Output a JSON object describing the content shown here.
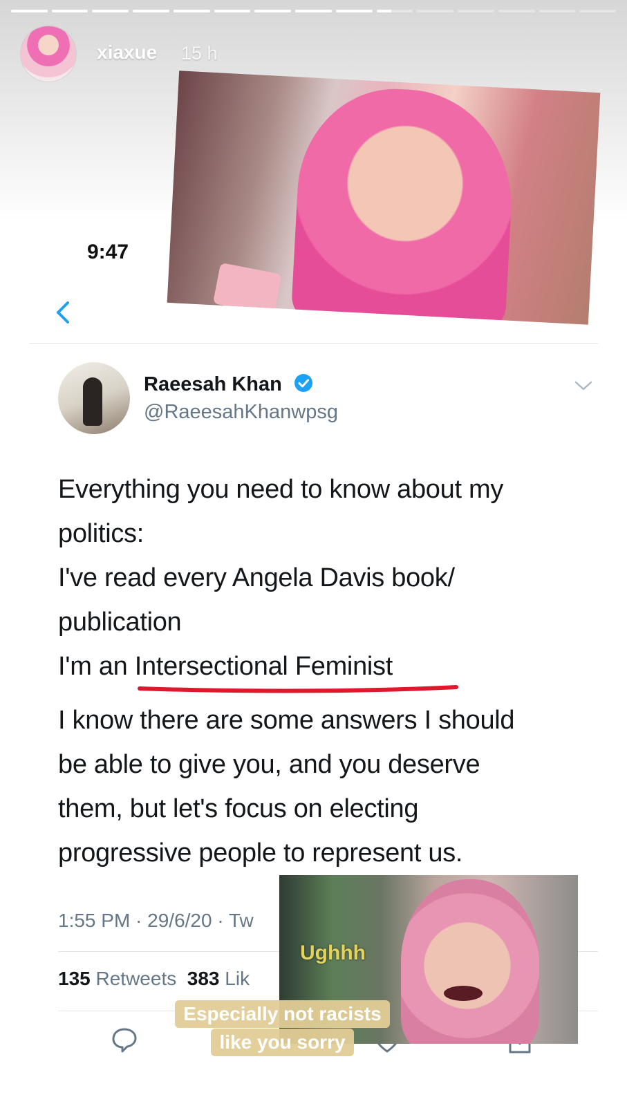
{
  "story": {
    "username": "xiaxue",
    "time_ago": "15 h",
    "progress_segments": 15,
    "progress_current_index": 9
  },
  "status_bar": {
    "time": "9:47"
  },
  "tweet": {
    "display_name": "Raeesah Khan",
    "handle": "@RaeesahKhanwpsg",
    "verified": true,
    "body_lines": [
      "Everything you need to know about my",
      "politics:",
      "I've read every Angela Davis book/",
      "publication",
      "I'm an ",
      "Intersectional Feminist",
      "I know there are some answers I should",
      "be able to give you, and you deserve",
      "them, but let's focus on electing",
      "progressive people to represent us."
    ],
    "meta": "1:55 PM · 29/6/20 · Tw",
    "retweets_count": "135",
    "retweets_label": "Retweets",
    "likes_count": "383",
    "likes_label": "Lik"
  },
  "stickers": {
    "gif_text": "Ughhh",
    "caption_line1": "Especially not racists",
    "caption_line2": "like you sorry"
  },
  "icons": {
    "back": "chevron-left-icon",
    "verified": "verified-badge-icon",
    "more": "chevron-down-icon",
    "reply": "reply-icon",
    "like": "heart-icon",
    "share": "share-icon"
  },
  "colors": {
    "twitter_blue": "#1da1f2",
    "underline_red": "#e0182d",
    "caption_bg": "#e2cc96",
    "gif_text": "#e4d25a"
  }
}
